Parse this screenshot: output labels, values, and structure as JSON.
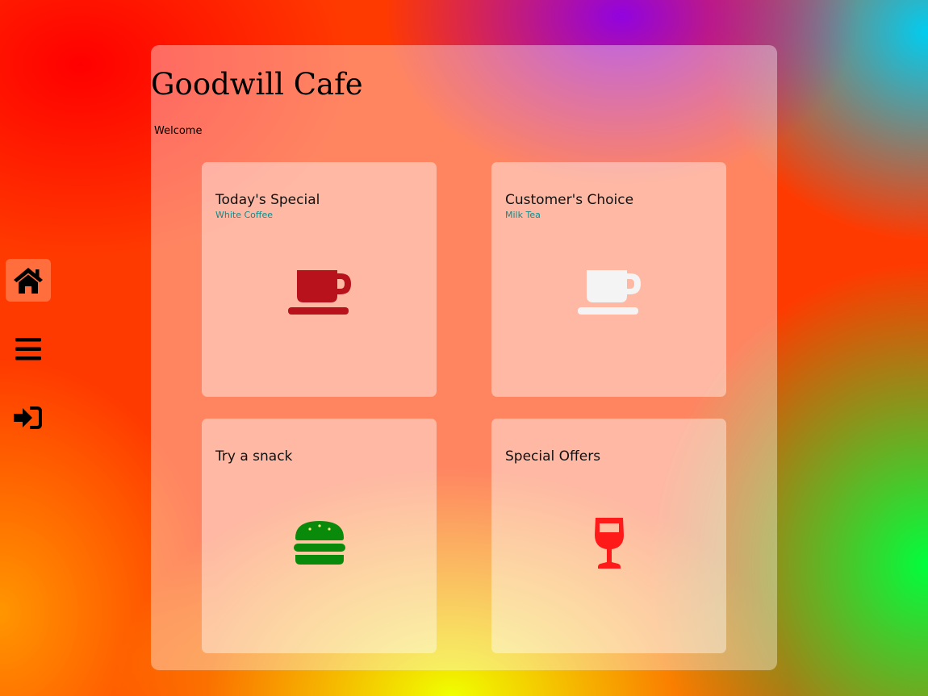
{
  "app": {
    "title": "Goodwill Cafe",
    "welcome": "Welcome"
  },
  "sidebar": {
    "items": [
      {
        "icon": "home-icon",
        "active": true
      },
      {
        "icon": "menu-icon",
        "active": false
      },
      {
        "icon": "sign-in-icon",
        "active": false
      }
    ]
  },
  "cards": [
    {
      "title": "Today's Special",
      "subtitle": "White Coffee",
      "icon": "coffee-cup-icon",
      "icon_color": "#b8131c"
    },
    {
      "title": "Customer's Choice",
      "subtitle": "Milk Tea",
      "icon": "coffee-cup-icon",
      "icon_color": "#f4f4f4"
    },
    {
      "title": "Try a snack",
      "subtitle": "",
      "icon": "burger-icon",
      "icon_color": "#0a8a0a"
    },
    {
      "title": "Special Offers",
      "subtitle": "",
      "icon": "wine-glass-icon",
      "icon_color": "#ff1a1a"
    }
  ],
  "colors": {
    "subtitle": "#0f8a8a",
    "active_nav": "#ff7846"
  }
}
